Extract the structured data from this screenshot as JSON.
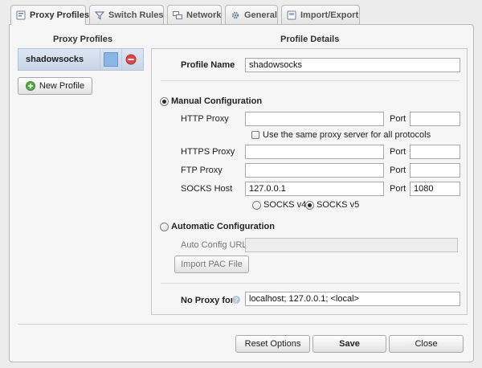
{
  "tabs": [
    {
      "label": "Proxy Profiles",
      "icon": "proxy-profiles-icon",
      "active": true
    },
    {
      "label": "Switch Rules",
      "icon": "filter-icon",
      "active": false
    },
    {
      "label": "Network",
      "icon": "network-icon",
      "active": false
    },
    {
      "label": "General",
      "icon": "gear-icon",
      "active": false
    },
    {
      "label": "Import/Export",
      "icon": "import-export-icon",
      "active": false
    }
  ],
  "profiles": {
    "title": "Proxy Profiles",
    "items": [
      {
        "name": "shadowsocks",
        "color": "#89b6e6"
      }
    ],
    "new_profile_label": "New Profile"
  },
  "details": {
    "title": "Profile Details",
    "profile_name_label": "Profile Name",
    "profile_name_value": "shadowsocks",
    "manual": {
      "label": "Manual Configuration",
      "selected": true,
      "http_label": "HTTP Proxy",
      "http_host": "",
      "http_port": "",
      "same_proxy_label": "Use the same proxy server for all protocols",
      "same_proxy_checked": false,
      "https_label": "HTTPS Proxy",
      "https_host": "",
      "https_port": "",
      "ftp_label": "FTP Proxy",
      "ftp_host": "",
      "ftp_port": "",
      "socks_label": "SOCKS Host",
      "socks_host": "127.0.0.1",
      "socks_port": "1080",
      "port_label": "Port",
      "socks_v4_label": "SOCKS v4",
      "socks_v5_label": "SOCKS v5",
      "socks_version": "v5"
    },
    "automatic": {
      "label": "Automatic Configuration",
      "selected": false,
      "url_label": "Auto Config URL",
      "url_value": "",
      "import_pac_label": "Import PAC File"
    },
    "no_proxy_label": "No Proxy for",
    "no_proxy_value": "localhost; 127.0.0.1; <local>"
  },
  "footer": {
    "reset_label": "Reset Options",
    "save_label": "Save",
    "close_label": "Close"
  },
  "colors": {
    "selected_profile_bg": "#c9d6e8",
    "delete_red": "#e24545",
    "new_profile_green": "#4fae3e"
  }
}
